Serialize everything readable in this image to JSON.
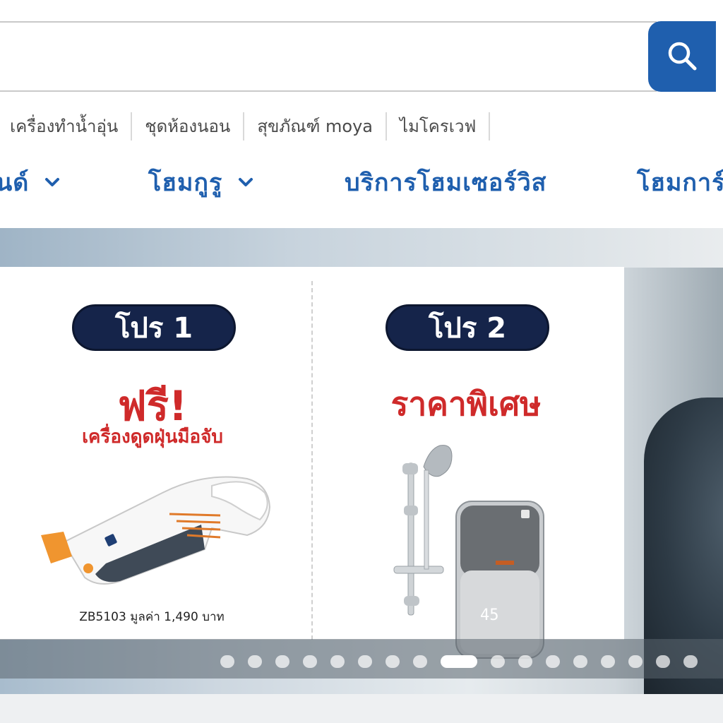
{
  "search": {
    "placeholder": "",
    "value": ""
  },
  "quick_links": [
    {
      "label": "เครื่องทำน้ำอุ่น"
    },
    {
      "label": "ชุดห้องนอน"
    },
    {
      "label": "สุขภัณฑ์ moya"
    },
    {
      "label": "ไมโครเวฟ"
    }
  ],
  "nav": {
    "items": [
      {
        "label": "นด์"
      },
      {
        "label": "โฮมกูรู"
      },
      {
        "label": "บริการโฮมเซอร์วิส"
      },
      {
        "label": "โฮมการ์"
      }
    ]
  },
  "banner": {
    "promo1": {
      "pill": "โปร 1",
      "headline": "ฟรี!",
      "subheadline": "เครื่องดูดฝุ่นมือจับ",
      "caption": "ZB5103 มูลค่า 1,490 บาท"
    },
    "promo2": {
      "pill": "โปร 2",
      "headline": "ราคาพิเศษ",
      "display_readout": "45"
    },
    "slide_count": 17,
    "active_slide": 9
  },
  "colors": {
    "brand_blue": "#1f5fae",
    "promo_red": "#cf2a2a",
    "pill_navy": "#15244a",
    "accent_orange": "#e07a2a"
  },
  "icons": {
    "search": "search-icon",
    "chevron": "chevron-down-icon"
  }
}
